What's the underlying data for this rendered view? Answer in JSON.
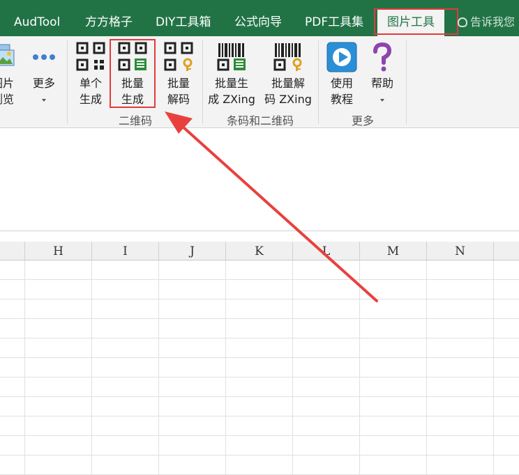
{
  "tabs": [
    {
      "id": "audtool",
      "label": "AudTool"
    },
    {
      "id": "ffgz",
      "label": "方方格子"
    },
    {
      "id": "diy",
      "label": "DIY工具箱"
    },
    {
      "id": "formula",
      "label": "公式向导"
    },
    {
      "id": "pdf",
      "label": "PDF工具集"
    },
    {
      "id": "image",
      "label": "图片工具"
    }
  ],
  "tell_me": "告诉我您",
  "ribbon": {
    "buttons": {
      "image_browse": "图片\n浏览",
      "more": "更多",
      "single_gen": "单个\n生成",
      "batch_gen": "批量\n生成",
      "batch_decode": "批量\n解码",
      "zxing_gen": "批量生\n成 ZXing",
      "zxing_decode": "批量解\n码 ZXing",
      "tutorial": "使用\n教程",
      "help": "帮助"
    },
    "groups": {
      "qrcode": "二维码",
      "barcode": "条码和二维码",
      "more": "更多"
    }
  },
  "columns": [
    "H",
    "I",
    "J",
    "K",
    "L",
    "M",
    "N"
  ],
  "colors": {
    "excel_green": "#217346",
    "highlight_red": "#e23a3a",
    "qr_green": "#2e8b3a",
    "key_gold": "#e0a020",
    "help_purple": "#8e44ad",
    "play_blue": "#2b8fd6"
  },
  "icons": {
    "image_browse": "pictures-icon",
    "more": "ellipsis-icon",
    "single_gen": "qr-code-icon",
    "batch_gen": "qr-code-list-icon",
    "batch_decode": "qr-code-key-icon",
    "zxing_gen": "barcode-list-icon",
    "zxing_decode": "barcode-key-icon",
    "tutorial": "play-icon",
    "help": "question-mark-icon"
  }
}
